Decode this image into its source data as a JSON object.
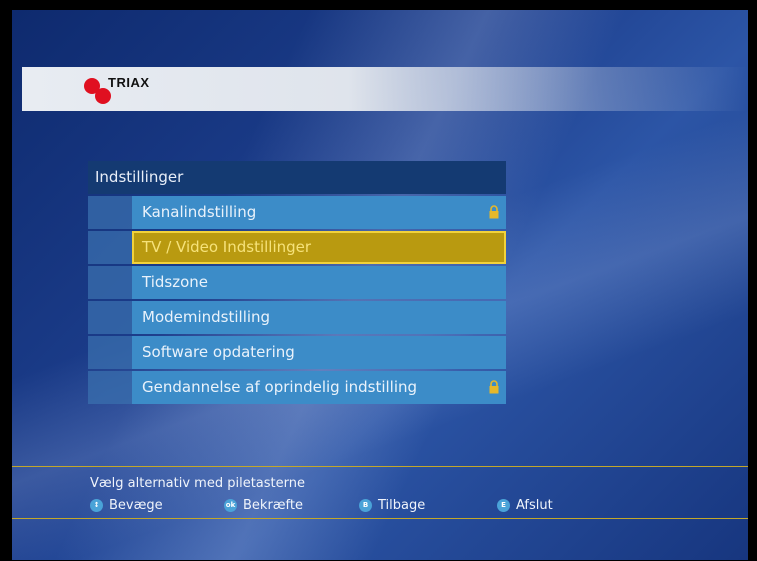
{
  "brand": {
    "name": "TRIAX",
    "accent": "#e01020"
  },
  "menu": {
    "title": "Indstillinger",
    "items": [
      {
        "label": "Kanalindstilling",
        "locked": true
      },
      {
        "label": "TV / Video Indstillinger",
        "selected": true
      },
      {
        "label": "Tidszone"
      },
      {
        "label": "Modemindstilling"
      },
      {
        "label": "Software opdatering"
      },
      {
        "label": "Gendannelse af oprindelig indstilling",
        "locked": true
      }
    ]
  },
  "footer": {
    "hint": "Vælg alternativ med piletasterne",
    "legend": [
      {
        "key": "arrows-icon",
        "key_text": "",
        "label": "Bevæge"
      },
      {
        "key": "ok-icon",
        "key_text": "ok",
        "label": "Bekræfte"
      },
      {
        "key": "back-icon",
        "key_text": "B",
        "label": "Tilbage"
      },
      {
        "key": "exit-icon",
        "key_text": "E",
        "label": "Afslut"
      }
    ]
  }
}
